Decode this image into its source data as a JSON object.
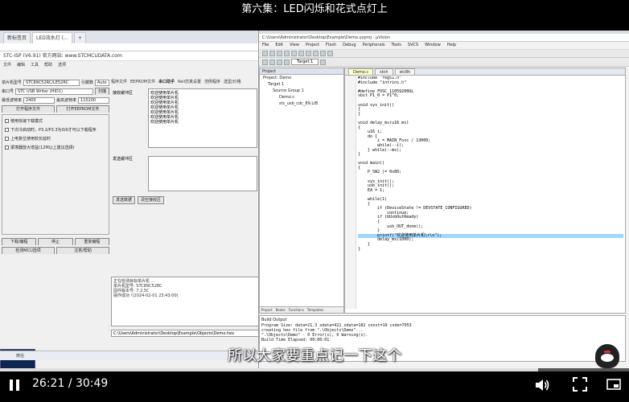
{
  "video": {
    "title": "第六集：LED闪烁和花式点灯上",
    "subtitle": "所以大家要重点记一下这个",
    "current_time": "26:21",
    "duration": "30:49",
    "progress_fraction": 0.855
  },
  "left_app": {
    "tabs": [
      "新标签页",
      "LED流水灯 (...",
      "+"
    ],
    "stc_title": "STC-ISP (V6.91) 官方网站: www.STCMCUDATA.com",
    "menu": [
      "文件",
      "编辑",
      "工具",
      "帮助",
      "选项"
    ],
    "mcu_label": "单片机型号",
    "mcu_value": "STC89C52RC/LE52RC",
    "pin_label": "引脚数",
    "pin_value": "Auto",
    "port_label": "串口号",
    "port_value": "STC USB Writer (HID1)",
    "scan_btn": "扫描",
    "baud_min_label": "最低波特率",
    "baud_min": "2400",
    "baud_max_label": "最高波特率",
    "baud_max": "115200",
    "open_file_btn": "打开程序文件",
    "open_eeprom_btn": "打开EEPROM文件",
    "options": [
      "使用快速下载模式",
      "下次冷启动时，P3.2/P3.3为0/0才可以下载程序",
      "上电复位使用较长延时",
      "振荡器放大增益(12M以上建议选择)"
    ],
    "download_btn": "下载/编程",
    "stop_btn": "停止",
    "reprogram_btn": "重复编程",
    "detect_btn": "检测MCU选项",
    "help_btn": "注意/帮助",
    "right_tabs": [
      "程序文件",
      "EEPROM文件",
      "串口助手",
      "Keil仿真设置",
      "范例程序",
      "选型/价格"
    ],
    "recv_label": "接收缓冲区",
    "recv_lines": [
      "欢迎使用单片机",
      "欢迎使用单片机",
      "欢迎使用单片机",
      "欢迎使用单片机",
      "欢迎使用单片机",
      "欢迎使用单片机",
      "欢迎使用单片机"
    ],
    "send_label": "发送缓冲区",
    "send_btn": "发送数据",
    "clear_btn": "清空接收区",
    "log_lines": [
      "正在检测目标单片机 ...",
      "单片机型号: STC89C52RC",
      "固件版本号: 7.2.5C",
      "操作成功 !(2024-02-01 23:43:00)"
    ],
    "file_path": "C:\\Users\\Administrator\\Desktop\\Example\\Objects\\Demo.hex",
    "taskbar_text": "微信"
  },
  "keil": {
    "title": "C:\\Users\\Administrator\\Desktop\\Example\\Demo.uvproj - µVision",
    "menu": [
      "File",
      "Edit",
      "View",
      "Project",
      "Flash",
      "Debug",
      "Peripherals",
      "Tools",
      "SVCS",
      "Window",
      "Help"
    ],
    "target": "Target 1",
    "project_header": "Project",
    "tree": [
      "Project: Demo",
      "Target 1",
      "Source Group 1",
      "Demo.c",
      "stc_usb_cdc_89.LIB"
    ],
    "project_tabs": [
      "Project",
      "Books",
      "Functions",
      "Templates"
    ],
    "editor_tabs": [
      "Demo.c",
      "stch",
      "stc8h"
    ],
    "code_lines": [
      "#include \"reg51.h\"",
      "#include \"intrins.h\"",
      "",
      "#define FOSC 11059200UL",
      "sbit P1_0 = P1^0;",
      "",
      "void sys_init()",
      "{",
      "}",
      "",
      "void delay_ms(u16 ms)",
      "{",
      "    u16 i;",
      "    do {",
      "        i = MAIN_Fosc / 13000;",
      "        while(--i);",
      "    } while(--ms);",
      "}",
      "",
      "void main()",
      "{",
      "    P_SW2 |= 0x80;",
      "",
      "    sys_init();",
      "    usb_init();",
      "    EA = 1;",
      "",
      "    while(1)",
      "    {",
      "        if (DeviceState != DEVSTATE_CONFIGURED)",
      "            continue;",
      "        if (bUsbOutReady)",
      "        {",
      "            usb_OUT_done();",
      "        }",
      "        printf(\"欢迎使用单片机\\r\\n\");",
      "        delay_ms(1000);",
      "    }",
      "}"
    ],
    "highlight_line": 35,
    "build_header": "Build Output",
    "build_lines": [
      "Program Size: data=21.3 xdata=421 xdata=182 const=10 code=7053",
      "creating hex file from \".\\Objects\\Demo\"...",
      "\".\\Objects\\Demo\" - 0 Error(s), 0 Warning(s).",
      "Build Time Elapsed:  00:00:01"
    ]
  }
}
